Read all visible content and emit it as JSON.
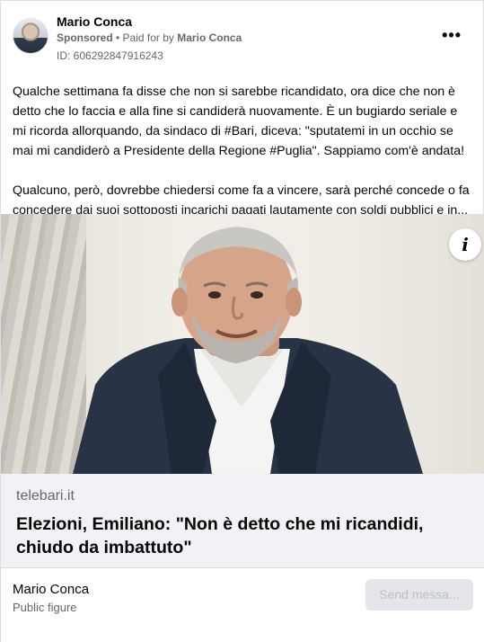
{
  "post": {
    "author": "Mario Conca",
    "sponsored_label": "Sponsored",
    "separator": " • ",
    "paid_for_by": "Paid for by",
    "payer": "Mario Conca",
    "ad_id": "ID: 606292847916243",
    "more_icon": "•••",
    "paragraphs": [
      "Qualche settimana fa disse che non si sarebbe ricandidato, ora dice che non è detto che lo faccia e alla fine si candiderà nuovamente. È un bugiardo seriale e mi ricorda allorquando, da sindaco di #Bari, diceva: \"sputatemi in un occhio se mai mi candiderò a Presidente della Regione #Puglia\". Sappiamo com'è andata!",
      "Qualcuno, però, dovrebbe chiedersi come fa a vincere, sarà perché concede o fa concedere dai suoi sottoposti incarichi pagati lautamente con soldi pubblici e in..."
    ]
  },
  "media": {
    "info_icon": "i",
    "icon_name": "info-icon"
  },
  "link": {
    "domain": "telebari.it",
    "headline": "Elezioni, Emiliano: \"Non è detto che mi ricandidi, chiudo da imbattuto\""
  },
  "footer": {
    "page_name": "Mario Conca",
    "page_category": "Public figure",
    "send_button": "Send messa..."
  }
}
